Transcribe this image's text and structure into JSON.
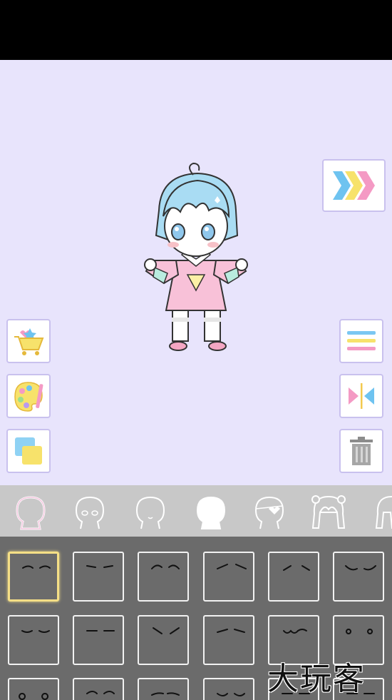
{
  "app": {
    "accent_colors": {
      "canvas": "#e8e4fc",
      "button_border": "#c9c1ee",
      "tabs_bar": "#c8c8c8",
      "grid_bg": "#6b6b6b",
      "selected_tile": "#f5df86"
    }
  },
  "toolbar_right": {
    "next_icon": "triple-chevron-right-icon",
    "menu_icon": "hamburger-menu-icon",
    "flip_icon": "flip-horizontal-icon",
    "delete_icon": "trash-icon"
  },
  "toolbar_left": {
    "shop_icon": "shopping-cart-icon",
    "palette_icon": "paint-palette-icon",
    "layers_icon": "layers-icon"
  },
  "category_tabs": [
    {
      "icon": "body-outline-icon",
      "selected": true
    },
    {
      "icon": "face-eyes-icon",
      "selected": false
    },
    {
      "icon": "face-mouth-icon",
      "selected": false
    },
    {
      "icon": "face-blank-icon",
      "selected": false
    },
    {
      "icon": "face-eyepatch-icon",
      "selected": false
    },
    {
      "icon": "hair-front-icon",
      "selected": false
    },
    {
      "icon": "hair-side-icon",
      "selected": false
    }
  ],
  "expression_grid": {
    "selected_index": 0,
    "rows": 3,
    "columns": 6
  },
  "watermark": "大玩客"
}
